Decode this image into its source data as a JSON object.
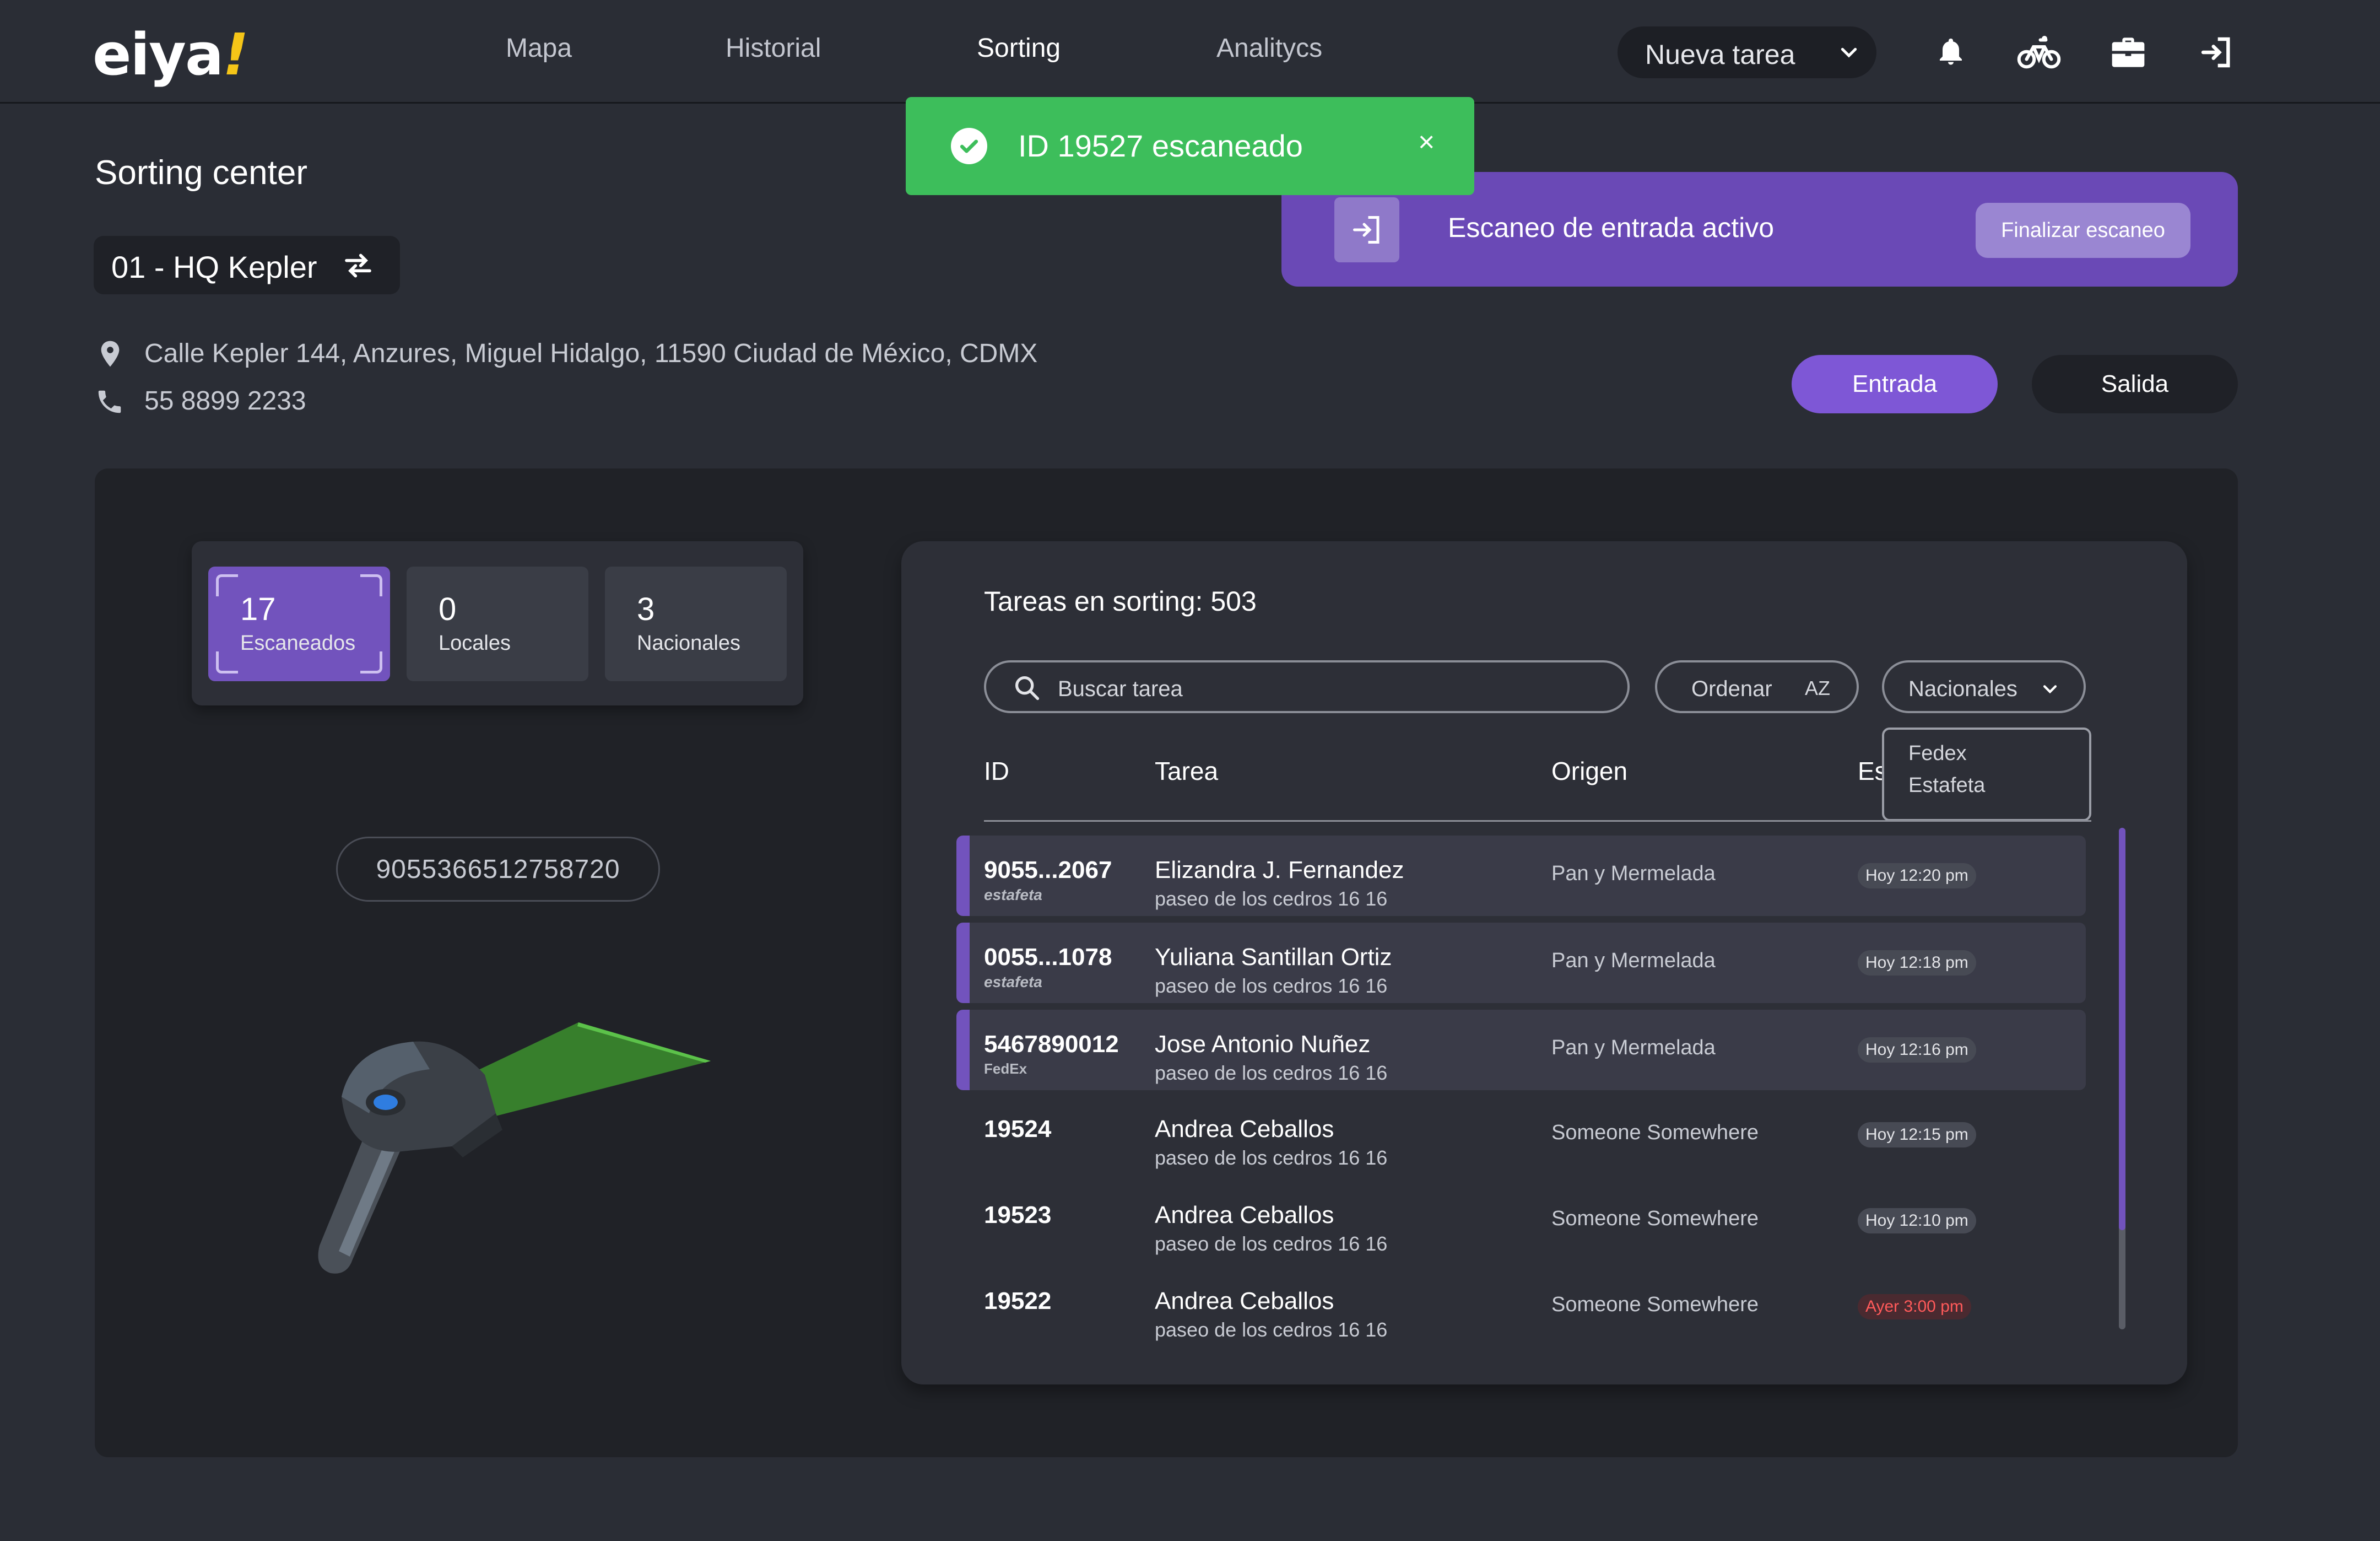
{
  "brand": {
    "logo_text": "eiya",
    "logo_bang": "!"
  },
  "nav": {
    "items": [
      {
        "label": "Mapa"
      },
      {
        "label": "Historial"
      },
      {
        "label": "Sorting"
      },
      {
        "label": "Analitycs"
      }
    ],
    "active": "Sorting",
    "new_task_label": "Nueva tarea",
    "icons": [
      "bell-icon",
      "bike-icon",
      "briefcase-icon",
      "logout-icon"
    ]
  },
  "toast": {
    "message": "ID 19527 escaneado",
    "close": "×",
    "color": "#3dbe5b"
  },
  "scan_banner": {
    "text": "Escaneo de entrada activo",
    "button": "Finalizar escaneo",
    "color": "#6a49b6"
  },
  "page": {
    "title": "Sorting center",
    "site": "01 - HQ Kepler",
    "address": "Calle Kepler 144, Anzures, Miguel Hidalgo, 11590 Ciudad de México, CDMX",
    "phone": "55 8899 2233"
  },
  "actions": {
    "entrada": "Entrada",
    "salida": "Salida",
    "accent": "#7e57d6"
  },
  "stats": [
    {
      "value": "17",
      "label": "Escaneados",
      "active": true
    },
    {
      "value": "0",
      "label": "Locales",
      "active": false
    },
    {
      "value": "3",
      "label": "Nacionales",
      "active": false
    }
  ],
  "barcode": "9055366512758720",
  "table": {
    "title": "Tareas en sorting: 503",
    "search_placeholder": "Buscar tarea",
    "sort_label": "Ordenar",
    "sort_icon": "AZ",
    "filter_label": "Nacionales",
    "filter_options": [
      "Fedex",
      "Estafeta"
    ],
    "headers": {
      "id": "ID",
      "task": "Tarea",
      "origin": "Origen",
      "status": "Es"
    },
    "rows": [
      {
        "id": "9055...2067",
        "carrier": "estafeta",
        "name": "Elizandra J. Fernandez",
        "address": "paseo de los cedros 16 16",
        "origin": "Pan y Mermelada",
        "time": "Hoy 12:20 pm"
      },
      {
        "id": "0055...1078",
        "carrier": "estafeta",
        "name": "Yuliana Santillan Ortiz",
        "address": "paseo de los cedros 16 16",
        "origin": "Pan y Mermelada",
        "time": "Hoy 12:18 pm"
      },
      {
        "id": "5467890012",
        "carrier": "FedEx",
        "name": "Jose Antonio Nuñez",
        "address": "paseo de los cedros 16 16",
        "origin": "Pan y Mermelada",
        "time": "Hoy 12:16 pm"
      },
      {
        "id": "19524",
        "carrier": "",
        "name": "Andrea Ceballos",
        "address": "paseo de los cedros 16 16",
        "origin": "Someone Somewhere",
        "time": "Hoy 12:15 pm"
      },
      {
        "id": "19523",
        "carrier": "",
        "name": "Andrea Ceballos",
        "address": "paseo de los cedros 16 16",
        "origin": "Someone Somewhere",
        "time": "Hoy 12:10 pm"
      },
      {
        "id": "19522",
        "carrier": "",
        "name": "Andrea Ceballos",
        "address": "paseo de los cedros 16 16",
        "origin": "Someone Somewhere",
        "time": "Ayer 3:00 pm"
      }
    ]
  }
}
